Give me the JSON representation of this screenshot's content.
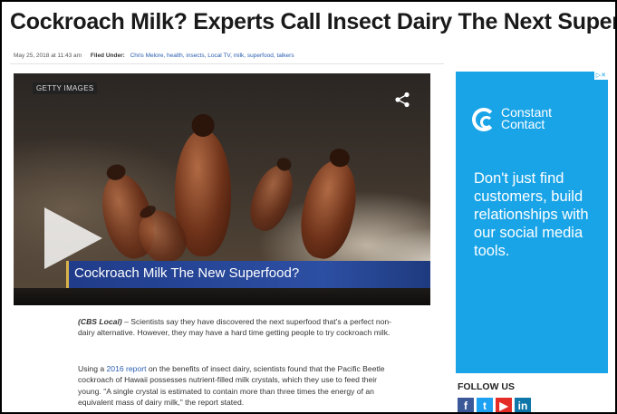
{
  "article": {
    "headline": "Cockroach Milk? Experts Call Insect Dairy The Next Superfood",
    "date": "May 25, 2018 at 11:43 am",
    "filed_under_label": "Filed Under:",
    "tags": "Chris Melore, health, insects, Local TV, milk, superfood, talkers",
    "video": {
      "watermark": "GETTY IMAGES",
      "caption": "Cockroach Milk The New Superfood?"
    },
    "p1": {
      "source": "(CBS Local)",
      "text": " – Scientists say they have discovered the next superfood that's a perfect non-dairy alternative. However, they may have a hard time getting people to try cockroach milk."
    },
    "p2": {
      "before": "Using a ",
      "link": "2016 report",
      "after": " on the benefits of insect dairy, scientists found that the Pacific Beetle cockroach of Hawaii possesses nutrient-filled milk crystals, which they use to feed their young. \"A single crystal is estimated to contain more than three times the energy of an equivalent mass of dairy milk,\" the report stated."
    }
  },
  "ad": {
    "close_label": "▷✕",
    "brand": "Constant Contact",
    "copy": "Don't just find customers, build relationships with our social media tools."
  },
  "sidebar": {
    "follow_label": "FOLLOW US",
    "socials": [
      "f",
      "t",
      "▶",
      "in"
    ]
  },
  "colors": {
    "link": "#2a5db0",
    "ad_bg": "#1aa4e8",
    "lower_third": "#2d4fa3"
  }
}
